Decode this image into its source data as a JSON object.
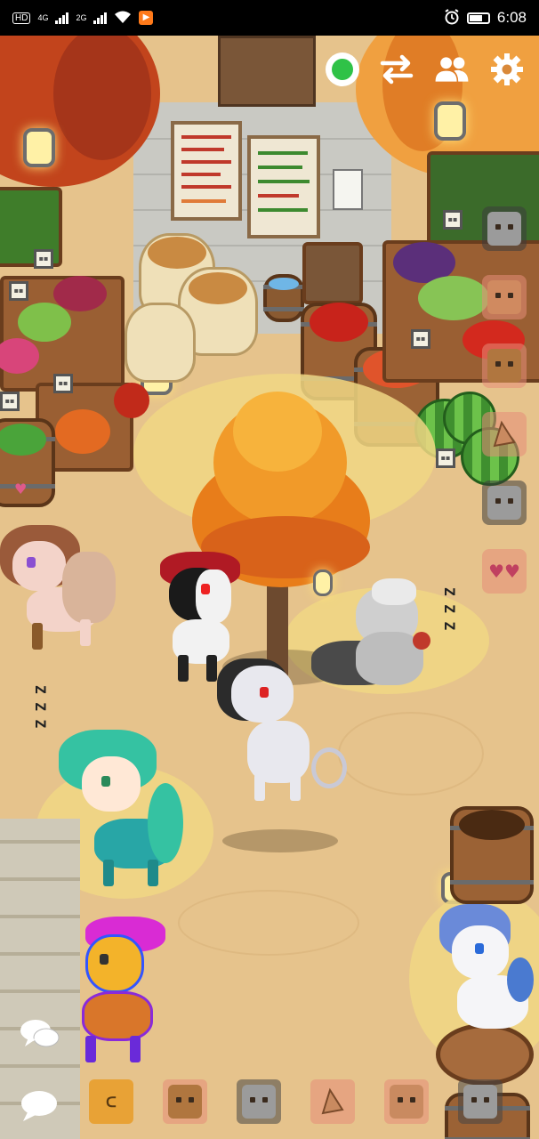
{
  "status_bar": {
    "network_label": "HD",
    "signal_1_label": "4G",
    "signal_2_label": "2G",
    "time": "6:08"
  },
  "hud": {
    "online_status_color": "#2fc247",
    "icons": [
      "online-status-icon",
      "swap-icon",
      "friends-icon",
      "settings-icon"
    ]
  },
  "side_actions": [
    "emote-boop-icon",
    "emote-blush-icon",
    "emote-smile-face-icon",
    "emote-ear-icon",
    "emote-sit-icon",
    "emote-heart-icon"
  ],
  "bottom_actions": [
    "emote-sleep-icon",
    "emote-grin-icon",
    "emote-lie-down-icon",
    "emote-ear-icon",
    "emote-sleepy-face-icon",
    "emote-grey-face-icon"
  ],
  "scene": {
    "zzz_left": "Z Z Z",
    "zzz_right": "Z Z Z",
    "zzz_far_left": "Z Z"
  }
}
